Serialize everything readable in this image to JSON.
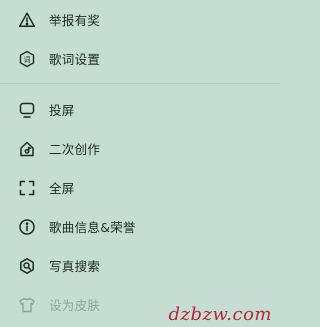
{
  "menu": {
    "group1": [
      {
        "label": "举报有奖",
        "icon": "warning-triangle-icon"
      },
      {
        "label": "歌词设置",
        "icon": "lyrics-icon"
      }
    ],
    "group2": [
      {
        "label": "投屏",
        "icon": "cast-screen-icon"
      },
      {
        "label": "二次创作",
        "icon": "remix-icon"
      },
      {
        "label": "全屏",
        "icon": "fullscreen-icon"
      },
      {
        "label": "歌曲信息&荣誉",
        "icon": "info-icon"
      },
      {
        "label": "写真搜索",
        "icon": "photo-search-icon"
      },
      {
        "label": "设为皮肤",
        "icon": "skin-shirt-icon",
        "disabled": true
      }
    ],
    "lyrics_icon_glyph": "词"
  },
  "watermark": "dzbzw.com",
  "colors": {
    "background": "#c5ddd2",
    "text": "#1f2a26",
    "disabled": "#8ea69b",
    "watermark": "#b8253a"
  }
}
